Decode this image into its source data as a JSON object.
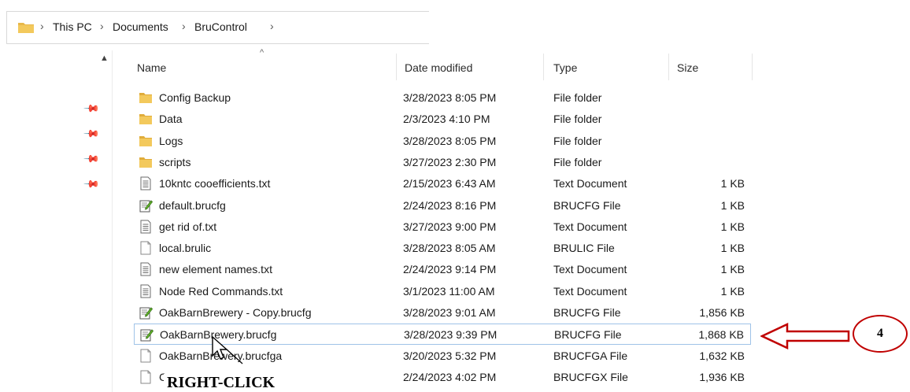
{
  "breadcrumb": {
    "items": [
      {
        "label": "This PC"
      },
      {
        "label": "Documents"
      },
      {
        "label": "BruControl"
      }
    ],
    "separator": "›"
  },
  "columns": {
    "name": "Name",
    "date": "Date modified",
    "type": "Type",
    "size": "Size"
  },
  "files": [
    {
      "icon": "folder-icon",
      "name": "Config Backup",
      "date": "3/28/2023 8:05 PM",
      "type": "File folder",
      "size": ""
    },
    {
      "icon": "folder-icon",
      "name": "Data",
      "date": "2/3/2023 4:10 PM",
      "type": "File folder",
      "size": ""
    },
    {
      "icon": "folder-icon",
      "name": "Logs",
      "date": "3/28/2023 8:05 PM",
      "type": "File folder",
      "size": ""
    },
    {
      "icon": "folder-icon",
      "name": "scripts",
      "date": "3/27/2023 2:30 PM",
      "type": "File folder",
      "size": ""
    },
    {
      "icon": "text-file-icon",
      "name": "10kntc cooefficients.txt",
      "date": "2/15/2023 6:43 AM",
      "type": "Text Document",
      "size": "1 KB"
    },
    {
      "icon": "config-file-icon",
      "name": "default.brucfg",
      "date": "2/24/2023 8:16 PM",
      "type": "BRUCFG File",
      "size": "1 KB"
    },
    {
      "icon": "text-file-icon",
      "name": "get rid of.txt",
      "date": "3/27/2023 9:00 PM",
      "type": "Text Document",
      "size": "1 KB"
    },
    {
      "icon": "blank-file-icon",
      "name": "local.brulic",
      "date": "3/28/2023 8:05 AM",
      "type": "BRULIC File",
      "size": "1 KB"
    },
    {
      "icon": "text-file-icon",
      "name": "new element names.txt",
      "date": "2/24/2023 9:14 PM",
      "type": "Text Document",
      "size": "1 KB"
    },
    {
      "icon": "text-file-icon",
      "name": "Node Red Commands.txt",
      "date": "3/1/2023 11:00 AM",
      "type": "Text Document",
      "size": "1 KB"
    },
    {
      "icon": "config-file-icon",
      "name": "OakBarnBrewery - Copy.brucfg",
      "date": "3/28/2023 9:01 AM",
      "type": "BRUCFG File",
      "size": "1,856 KB"
    },
    {
      "icon": "config-file-icon",
      "name": "OakBarnBrewery.brucfg",
      "date": "3/28/2023 9:39 PM",
      "type": "BRUCFG File",
      "size": "1,868 KB",
      "selected": true
    },
    {
      "icon": "blank-file-icon",
      "name": "OakBarnBrewery.brucfga",
      "date": "3/20/2023 5:32 PM",
      "type": "BRUCFGA File",
      "size": "1,632 KB"
    },
    {
      "icon": "blank-file-icon",
      "name": "C",
      "date": "2/24/2023 4:02 PM",
      "type": "BRUCFGX File",
      "size": "1,936 KB"
    }
  ],
  "annotations": {
    "step_number": "4",
    "action_label": "RIGHT-CLICK",
    "arrow_color": "#c00000"
  },
  "colors": {
    "folder": "#e8b84a",
    "selection_border": "#9fc3e8"
  }
}
